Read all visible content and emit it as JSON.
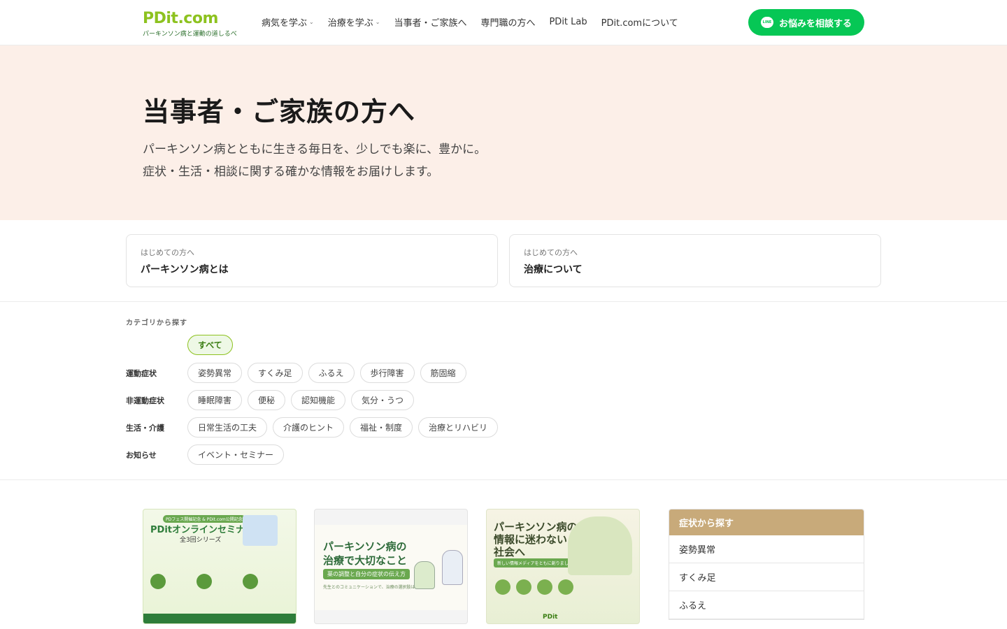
{
  "header": {
    "logo_main": "PDit.com",
    "logo_sub": "パーキンソン病と運動の道しるべ",
    "nav": [
      {
        "label": "病気を学ぶ",
        "has_caret": true
      },
      {
        "label": "治療を学ぶ",
        "has_caret": true
      },
      {
        "label": "当事者・ご家族へ",
        "has_caret": false
      },
      {
        "label": "専門職の方へ",
        "has_caret": false
      },
      {
        "label": "PDit Lab",
        "has_caret": false
      },
      {
        "label": "PDit.comについて",
        "has_caret": false
      }
    ],
    "cta_label": "お悩みを相談する",
    "cta_icon": "line-icon",
    "cta_color": "#06c755"
  },
  "hero": {
    "title": "当事者・ご家族の方へ",
    "desc_line1": "パーキンソン病とともに生きる毎日を、少しでも楽に、豊かに。",
    "desc_line2": "症状・生活・相談に関する確かな情報をお届けします。"
  },
  "intro_cards": [
    {
      "small": "はじめての方へ",
      "big": "パーキンソン病とは"
    },
    {
      "small": "はじめての方へ",
      "big": "治療について"
    }
  ],
  "filter": {
    "heading": "カテゴリから探す",
    "all_label": "すべて",
    "rows": [
      {
        "label": "運動症状",
        "chips": [
          "姿勢異常",
          "すくみ足",
          "ふるえ",
          "歩行障害",
          "筋固縮"
        ]
      },
      {
        "label": "非運動症状",
        "chips": [
          "睡眠障害",
          "便秘",
          "認知機能",
          "気分・うつ"
        ]
      },
      {
        "label": "生活・介護",
        "chips": [
          "日常生活の工夫",
          "介護のヒント",
          "福祉・制度",
          "治療とリハビリ"
        ]
      },
      {
        "label": "お知らせ",
        "chips": [
          "イベント・セミナー"
        ]
      }
    ]
  },
  "articles": {
    "thumb1": {
      "badge": "PDフェス開催記念 & PDit.com公開記念",
      "title": "PDitオンラインセミナー",
      "sub": "全3回シリーズ"
    },
    "thumb2": {
      "title1": "パーキンソン病の",
      "title2": "治療で大切なこと",
      "pill": "薬の調整と自分の症状の伝え方",
      "small": "先生とのコミュニケーションで、治療の選択肢は広がる"
    },
    "thumb3": {
      "title1": "パーキンソン病の",
      "title2": "情報に迷わない",
      "title3": "社会へ",
      "pill": "新しい情報メディアをともに創りましょう",
      "brand": "PDit"
    }
  },
  "sidebar": {
    "heading": "症状から探す",
    "heading_color": "#c8aa7a",
    "items": [
      "姿勢異常",
      "すくみ足",
      "ふるえ"
    ]
  },
  "colors": {
    "brand_green": "#8dc21f",
    "hero_bg": "#fcefe8"
  }
}
